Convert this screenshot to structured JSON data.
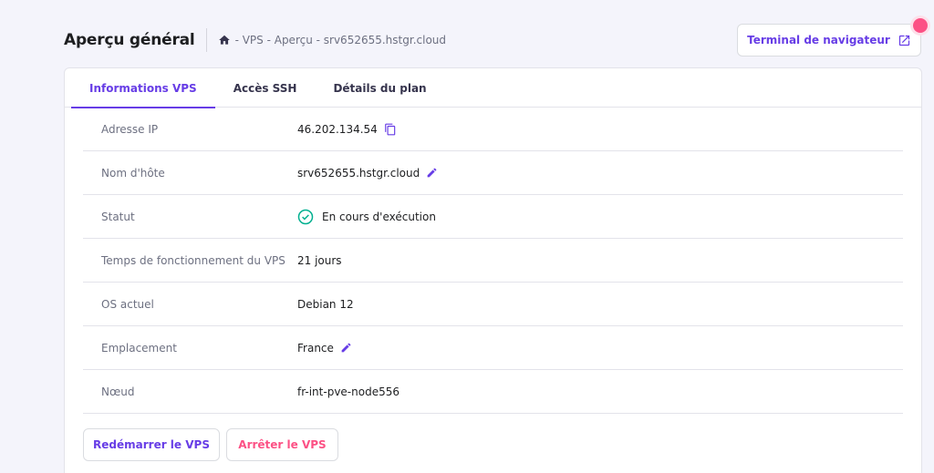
{
  "header": {
    "title": "Aperçu général",
    "breadcrumb": "- VPS - Aperçu - srv652655.hstgr.cloud",
    "terminal_button": "Terminal de navigateur"
  },
  "tabs": [
    {
      "label": "Informations VPS",
      "active": true
    },
    {
      "label": "Accès SSH",
      "active": false
    },
    {
      "label": "Détails du plan",
      "active": false
    }
  ],
  "info_rows": [
    {
      "label": "Adresse IP",
      "value": "46.202.134.54"
    },
    {
      "label": "Nom d'hôte",
      "value": "srv652655.hstgr.cloud"
    },
    {
      "label": "Statut",
      "value": "En cours d'exécution"
    },
    {
      "label": "Temps de fonctionnement du VPS",
      "value": "21 jours"
    },
    {
      "label": "OS actuel",
      "value": "Debian 12"
    },
    {
      "label": "Emplacement",
      "value": "France"
    },
    {
      "label": "Nœud",
      "value": "fr-int-pve-node556"
    }
  ],
  "actions": {
    "restart": "Redémarrer le VPS",
    "stop": "Arrêter le VPS"
  },
  "colors": {
    "accent": "#673de6",
    "danger": "#fc5185",
    "success": "#00b090"
  },
  "icons": [
    "home-icon",
    "external-link-icon",
    "copy-icon",
    "edit-icon",
    "check-circle-icon"
  ]
}
